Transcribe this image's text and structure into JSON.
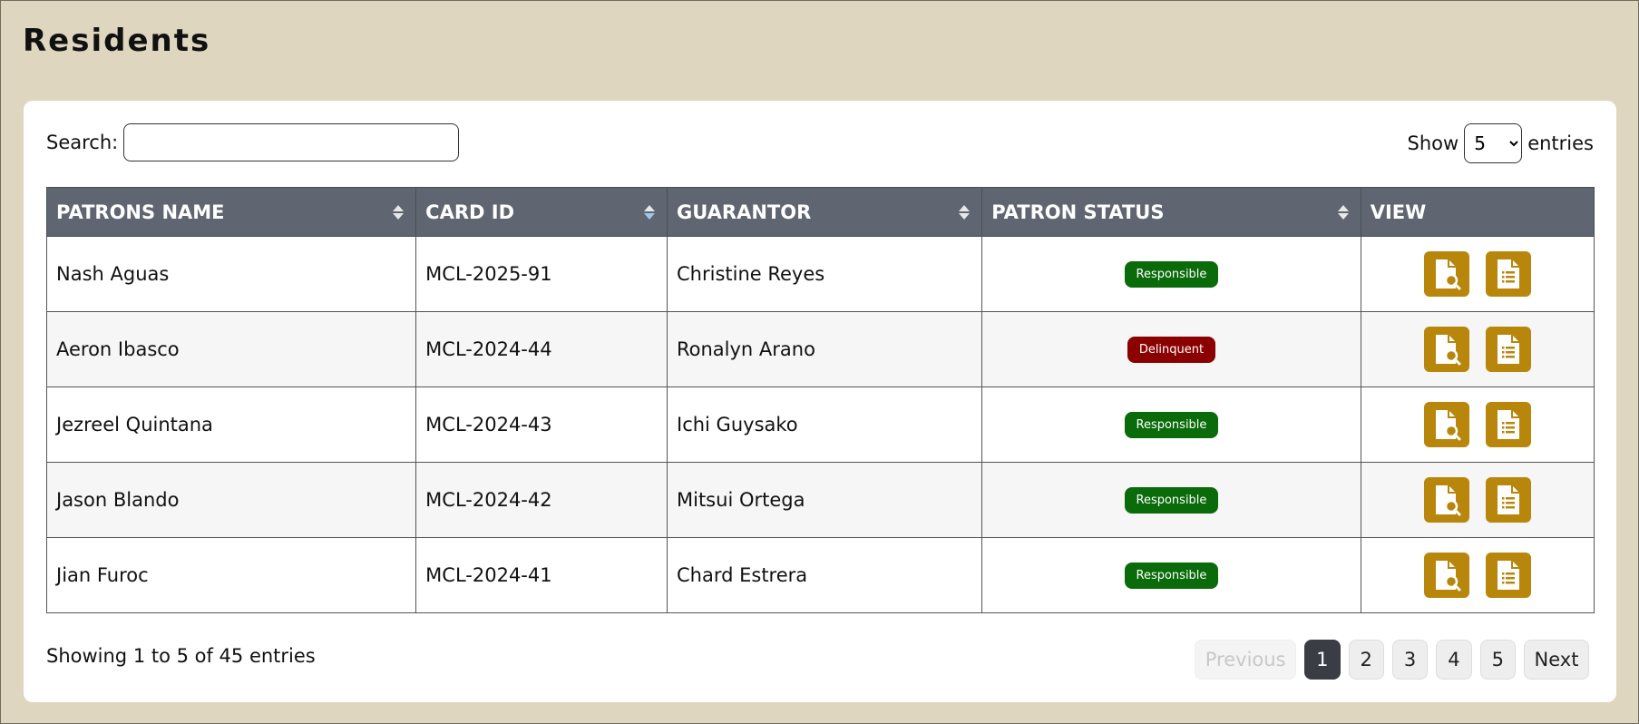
{
  "page": {
    "title": "Residents"
  },
  "controls": {
    "search_label": "Search:",
    "search_value": "",
    "show_label": "Show",
    "show_value": "5",
    "entries_label": "entries"
  },
  "table": {
    "headers": [
      "PATRONS NAME",
      "CARD ID",
      "GUARANTOR",
      "PATRON STATUS",
      "VIEW"
    ],
    "rows": [
      {
        "name": "Nash Aguas",
        "card_id": "MCL-2025-91",
        "guarantor": "Christine Reyes",
        "status": "Responsible"
      },
      {
        "name": "Aeron Ibasco",
        "card_id": "MCL-2024-44",
        "guarantor": "Ronalyn Arano",
        "status": "Delinquent"
      },
      {
        "name": "Jezreel Quintana",
        "card_id": "MCL-2024-43",
        "guarantor": "Ichi Guysako",
        "status": "Responsible"
      },
      {
        "name": "Jason Blando",
        "card_id": "MCL-2024-42",
        "guarantor": "Mitsui Ortega",
        "status": "Responsible"
      },
      {
        "name": "Jian Furoc",
        "card_id": "MCL-2024-41",
        "guarantor": "Chard Estrera",
        "status": "Responsible"
      }
    ]
  },
  "footer": {
    "info": "Showing 1 to 5 of 45 entries",
    "previous": "Previous",
    "pages": [
      "1",
      "2",
      "3",
      "4",
      "5"
    ],
    "next": "Next"
  },
  "colors": {
    "background": "#ded6bf",
    "header": "#5f6671",
    "responsible": "#0a6b0a",
    "delinquent": "#8b0000",
    "action": "#b8860b"
  },
  "icons": {
    "sort": "sort-icon",
    "view_profile": "file-search-icon",
    "view_records": "file-text-icon"
  }
}
